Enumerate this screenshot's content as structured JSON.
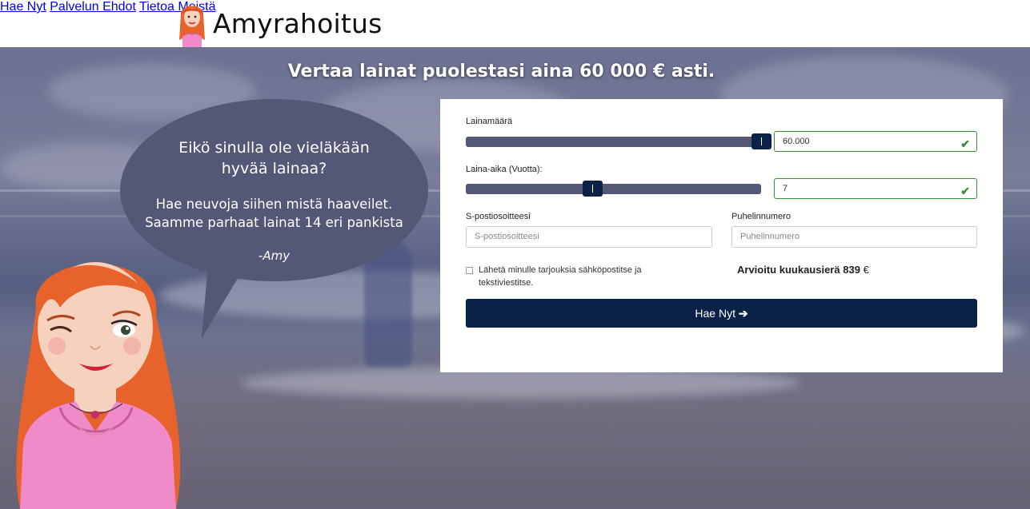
{
  "header": {
    "logo_text": "Amyrahoitus",
    "nav": [
      {
        "label": "Hae Nyt"
      },
      {
        "label": "Palvelun Ehdot"
      },
      {
        "label": "Tietoa Meistä"
      }
    ]
  },
  "hero": {
    "headline": "Vertaa lainat puolestasi aina 60 000 € asti."
  },
  "bubble": {
    "question_line1": "Eikö sinulla ole vieläkään",
    "question_line2": "hyvää lainaa?",
    "text_line1": "Hae neuvoja siihen mistä haaveilet.",
    "text_line2": "Saamme parhaat lainat 14 eri pankista",
    "signature": "-Amy"
  },
  "form": {
    "loan_amount_label": "Lainamäärä",
    "loan_amount_value": "60.000",
    "loan_amount_fraction": 1.0,
    "loan_term_label": "Laina-aika (Vuotta):",
    "loan_term_value": "7",
    "loan_term_fraction": 0.43,
    "email_label": "S-postiosoitteesi",
    "email_placeholder": "S-postiosoitteesi",
    "phone_label": "Puhelinnumero",
    "phone_placeholder": "Puhelinnumero",
    "consent_line1": "Lähetä minulle tarjouksia sähköpostitse ja",
    "consent_line2": "tekstiviestitse.",
    "estimate_label": "Arvioitu kuukausierä",
    "estimate_value": "839",
    "estimate_currency": "€",
    "submit_label": "Hae Nyt",
    "submit_icon": "arrow-right-icon"
  },
  "colors": {
    "navy": "#0a2248",
    "slider": "#545876",
    "valid_green": "#3c8a3c",
    "bubble": "#545876",
    "hair": "#e8622b",
    "shirt": "#f08ac8"
  }
}
